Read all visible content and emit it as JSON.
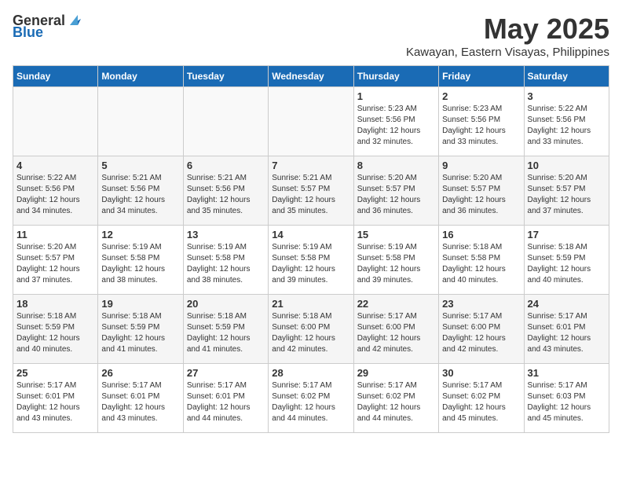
{
  "logo": {
    "general": "General",
    "blue": "Blue"
  },
  "title": "May 2025",
  "location": "Kawayan, Eastern Visayas, Philippines",
  "headers": [
    "Sunday",
    "Monday",
    "Tuesday",
    "Wednesday",
    "Thursday",
    "Friday",
    "Saturday"
  ],
  "weeks": [
    [
      {
        "day": "",
        "content": ""
      },
      {
        "day": "",
        "content": ""
      },
      {
        "day": "",
        "content": ""
      },
      {
        "day": "",
        "content": ""
      },
      {
        "day": "1",
        "content": "Sunrise: 5:23 AM\nSunset: 5:56 PM\nDaylight: 12 hours\nand 32 minutes."
      },
      {
        "day": "2",
        "content": "Sunrise: 5:23 AM\nSunset: 5:56 PM\nDaylight: 12 hours\nand 33 minutes."
      },
      {
        "day": "3",
        "content": "Sunrise: 5:22 AM\nSunset: 5:56 PM\nDaylight: 12 hours\nand 33 minutes."
      }
    ],
    [
      {
        "day": "4",
        "content": "Sunrise: 5:22 AM\nSunset: 5:56 PM\nDaylight: 12 hours\nand 34 minutes."
      },
      {
        "day": "5",
        "content": "Sunrise: 5:21 AM\nSunset: 5:56 PM\nDaylight: 12 hours\nand 34 minutes."
      },
      {
        "day": "6",
        "content": "Sunrise: 5:21 AM\nSunset: 5:56 PM\nDaylight: 12 hours\nand 35 minutes."
      },
      {
        "day": "7",
        "content": "Sunrise: 5:21 AM\nSunset: 5:57 PM\nDaylight: 12 hours\nand 35 minutes."
      },
      {
        "day": "8",
        "content": "Sunrise: 5:20 AM\nSunset: 5:57 PM\nDaylight: 12 hours\nand 36 minutes."
      },
      {
        "day": "9",
        "content": "Sunrise: 5:20 AM\nSunset: 5:57 PM\nDaylight: 12 hours\nand 36 minutes."
      },
      {
        "day": "10",
        "content": "Sunrise: 5:20 AM\nSunset: 5:57 PM\nDaylight: 12 hours\nand 37 minutes."
      }
    ],
    [
      {
        "day": "11",
        "content": "Sunrise: 5:20 AM\nSunset: 5:57 PM\nDaylight: 12 hours\nand 37 minutes."
      },
      {
        "day": "12",
        "content": "Sunrise: 5:19 AM\nSunset: 5:58 PM\nDaylight: 12 hours\nand 38 minutes."
      },
      {
        "day": "13",
        "content": "Sunrise: 5:19 AM\nSunset: 5:58 PM\nDaylight: 12 hours\nand 38 minutes."
      },
      {
        "day": "14",
        "content": "Sunrise: 5:19 AM\nSunset: 5:58 PM\nDaylight: 12 hours\nand 39 minutes."
      },
      {
        "day": "15",
        "content": "Sunrise: 5:19 AM\nSunset: 5:58 PM\nDaylight: 12 hours\nand 39 minutes."
      },
      {
        "day": "16",
        "content": "Sunrise: 5:18 AM\nSunset: 5:58 PM\nDaylight: 12 hours\nand 40 minutes."
      },
      {
        "day": "17",
        "content": "Sunrise: 5:18 AM\nSunset: 5:59 PM\nDaylight: 12 hours\nand 40 minutes."
      }
    ],
    [
      {
        "day": "18",
        "content": "Sunrise: 5:18 AM\nSunset: 5:59 PM\nDaylight: 12 hours\nand 40 minutes."
      },
      {
        "day": "19",
        "content": "Sunrise: 5:18 AM\nSunset: 5:59 PM\nDaylight: 12 hours\nand 41 minutes."
      },
      {
        "day": "20",
        "content": "Sunrise: 5:18 AM\nSunset: 5:59 PM\nDaylight: 12 hours\nand 41 minutes."
      },
      {
        "day": "21",
        "content": "Sunrise: 5:18 AM\nSunset: 6:00 PM\nDaylight: 12 hours\nand 42 minutes."
      },
      {
        "day": "22",
        "content": "Sunrise: 5:17 AM\nSunset: 6:00 PM\nDaylight: 12 hours\nand 42 minutes."
      },
      {
        "day": "23",
        "content": "Sunrise: 5:17 AM\nSunset: 6:00 PM\nDaylight: 12 hours\nand 42 minutes."
      },
      {
        "day": "24",
        "content": "Sunrise: 5:17 AM\nSunset: 6:01 PM\nDaylight: 12 hours\nand 43 minutes."
      }
    ],
    [
      {
        "day": "25",
        "content": "Sunrise: 5:17 AM\nSunset: 6:01 PM\nDaylight: 12 hours\nand 43 minutes."
      },
      {
        "day": "26",
        "content": "Sunrise: 5:17 AM\nSunset: 6:01 PM\nDaylight: 12 hours\nand 43 minutes."
      },
      {
        "day": "27",
        "content": "Sunrise: 5:17 AM\nSunset: 6:01 PM\nDaylight: 12 hours\nand 44 minutes."
      },
      {
        "day": "28",
        "content": "Sunrise: 5:17 AM\nSunset: 6:02 PM\nDaylight: 12 hours\nand 44 minutes."
      },
      {
        "day": "29",
        "content": "Sunrise: 5:17 AM\nSunset: 6:02 PM\nDaylight: 12 hours\nand 44 minutes."
      },
      {
        "day": "30",
        "content": "Sunrise: 5:17 AM\nSunset: 6:02 PM\nDaylight: 12 hours\nand 45 minutes."
      },
      {
        "day": "31",
        "content": "Sunrise: 5:17 AM\nSunset: 6:03 PM\nDaylight: 12 hours\nand 45 minutes."
      }
    ]
  ]
}
